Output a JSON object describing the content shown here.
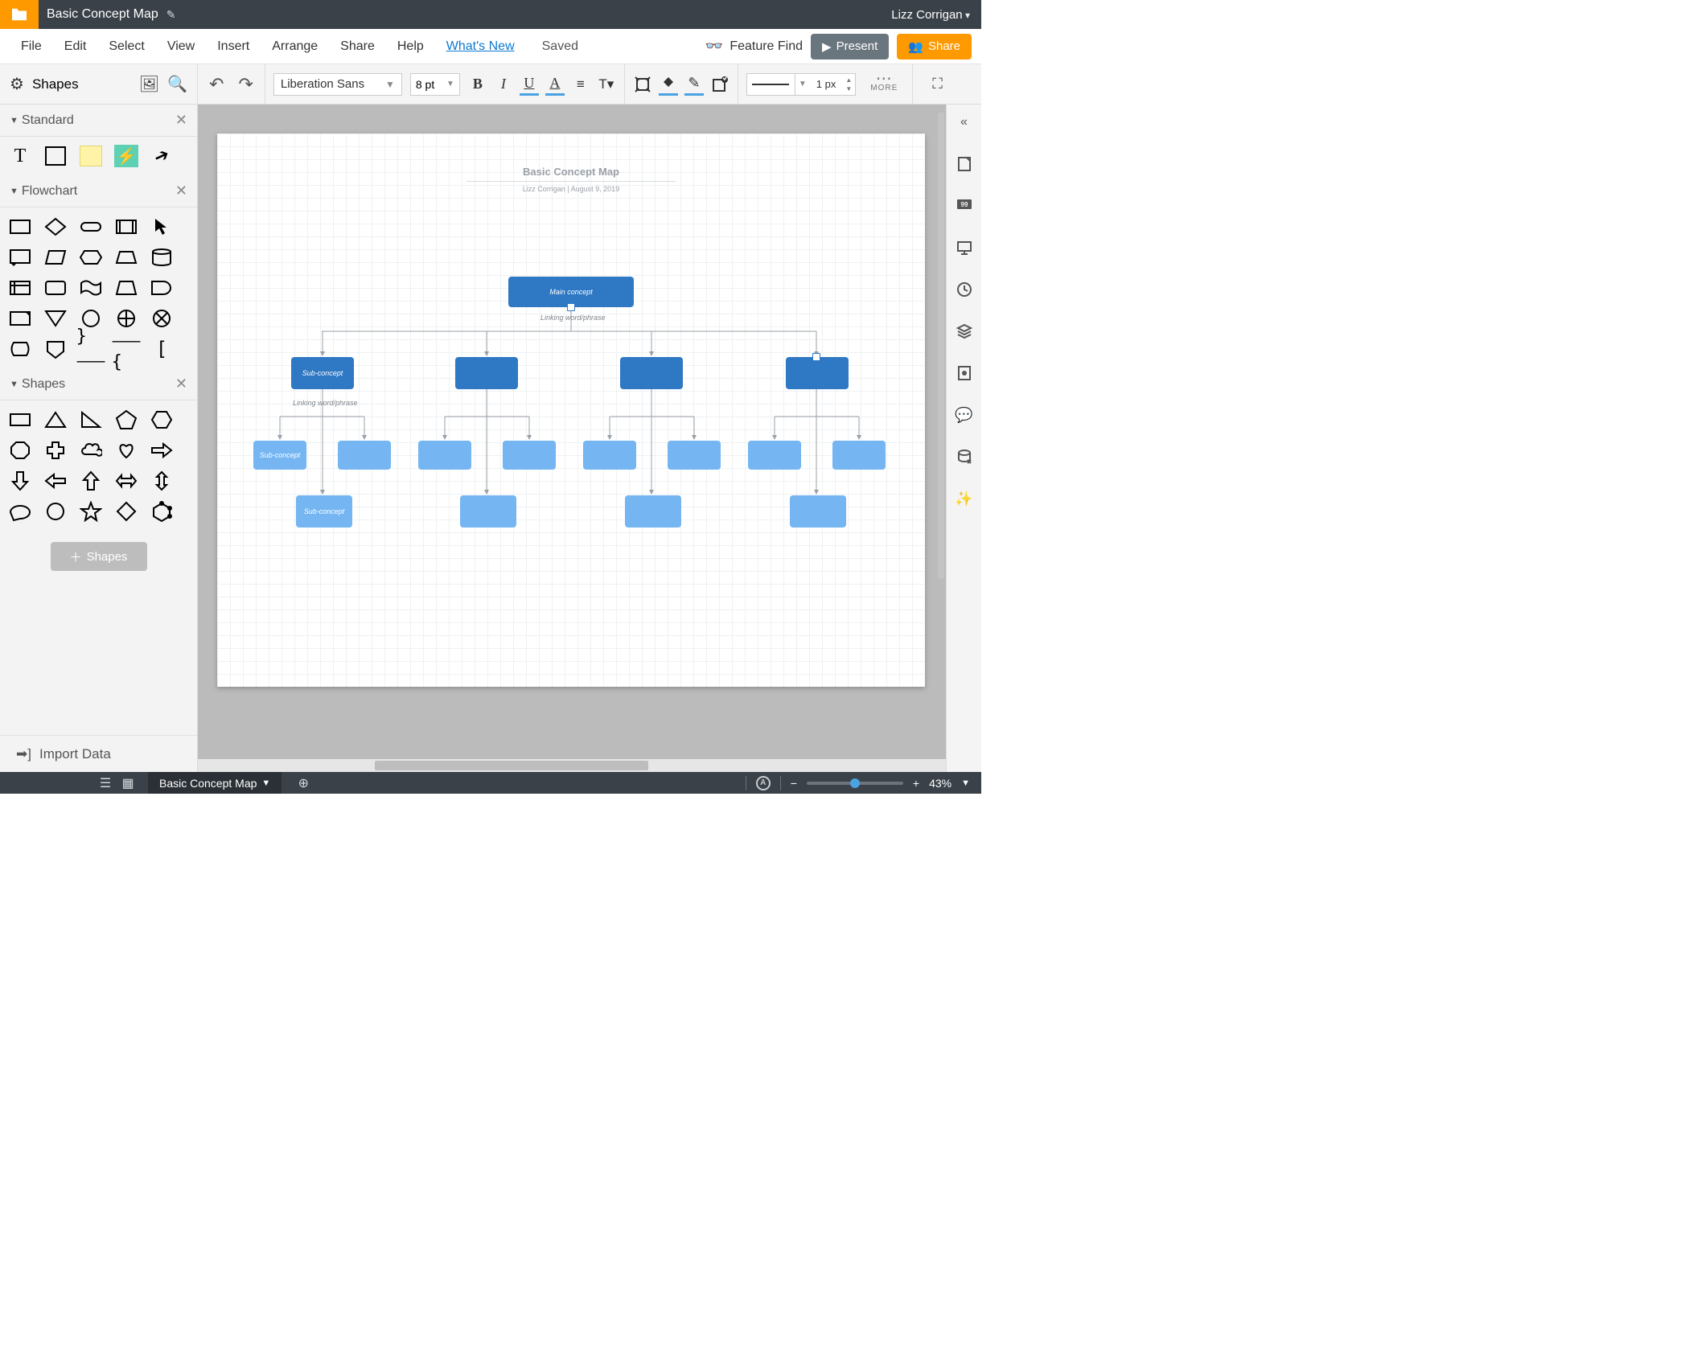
{
  "titlebar": {
    "doc_title": "Basic Concept Map",
    "user": "Lizz Corrigan"
  },
  "menubar": {
    "items": [
      "File",
      "Edit",
      "Select",
      "View",
      "Insert",
      "Arrange",
      "Share",
      "Help"
    ],
    "whats_new": "What's New",
    "saved": "Saved",
    "feature_find": "Feature Find",
    "present": "Present",
    "share": "Share"
  },
  "toolbar": {
    "shapes_label": "Shapes",
    "font": "Liberation Sans",
    "font_size": "8 pt",
    "line_width": "1 px",
    "more": "MORE"
  },
  "palette": {
    "sections": {
      "standard": "Standard",
      "flowchart": "Flowchart",
      "shapes": "Shapes"
    },
    "add_shapes": "Shapes",
    "import_data": "Import Data"
  },
  "diagram": {
    "title": "Basic Concept Map",
    "subtitle": "Lizz Corrigan   |   August 9, 2019",
    "main_concept": "Main concept",
    "linking": "Linking word/phrase",
    "sub_concept": "Sub-concept",
    "sub_concept2": "Sub-concept",
    "sub_concept3": "Sub-concept"
  },
  "status": {
    "page_tab": "Basic Concept Map",
    "zoom": "43%"
  }
}
